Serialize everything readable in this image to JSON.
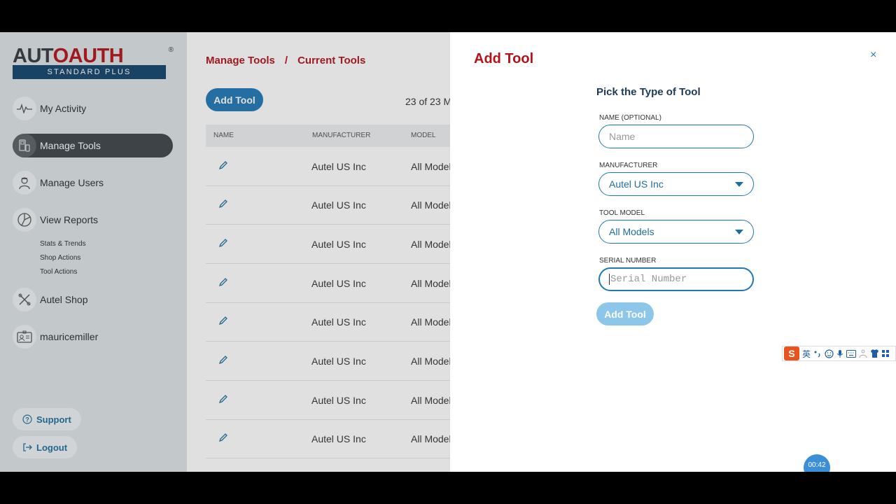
{
  "sidebar": {
    "logo": {
      "part1": "AUT",
      "part2": "O",
      "part3": "AUTH",
      "reg": "®",
      "tagline": "STANDARD PLUS"
    },
    "nav": [
      {
        "label": "My Activity",
        "icon": "activity-icon"
      },
      {
        "label": "Manage Tools",
        "icon": "tools-icon",
        "active": true
      },
      {
        "label": "Manage Users",
        "icon": "user-icon"
      },
      {
        "label": "View Reports",
        "icon": "reports-icon"
      }
    ],
    "sub_items": [
      "Stats & Trends",
      "Shop Actions",
      "Tool Actions"
    ],
    "shop": "Autel Shop",
    "user": "mauricemiller",
    "support": "Support",
    "logout": "Logout"
  },
  "main": {
    "breadcrumb": {
      "root": "Manage Tools",
      "sep": "/",
      "current": "Current Tools"
    },
    "add_tool_label": "Add Tool",
    "count_text": "23 of 23 M",
    "columns": [
      "NAME",
      "MANUFACTURER",
      "MODEL"
    ],
    "rows": [
      {
        "manufacturer": "Autel US Inc",
        "model": "All Model"
      },
      {
        "manufacturer": "Autel US Inc",
        "model": "All Model"
      },
      {
        "manufacturer": "Autel US Inc",
        "model": "All Model"
      },
      {
        "manufacturer": "Autel US Inc",
        "model": "All Model"
      },
      {
        "manufacturer": "Autel US Inc",
        "model": "All Model"
      },
      {
        "manufacturer": "Autel US Inc",
        "model": "All Model"
      },
      {
        "manufacturer": "Autel US Inc",
        "model": "All Model"
      },
      {
        "manufacturer": "Autel US Inc",
        "model": "All Model"
      }
    ]
  },
  "drawer": {
    "title": "Add Tool",
    "close": "×",
    "form_title": "Pick the Type of Tool",
    "name_label": "NAME (OPTIONAL)",
    "name_placeholder": "Name",
    "manufacturer_label": "MANUFACTURER",
    "manufacturer_value": "Autel US Inc",
    "model_label": "TOOL MODEL",
    "model_value": "All Models",
    "serial_label": "SERIAL NUMBER",
    "serial_placeholder": "Serial Number",
    "submit_label": "Add Tool"
  },
  "ime": {
    "logo": "S",
    "lang": "英"
  },
  "timer": "00:42",
  "colors": {
    "brand_red": "#b4121b",
    "accent_blue": "#1f78b4",
    "navy": "#13446c"
  }
}
